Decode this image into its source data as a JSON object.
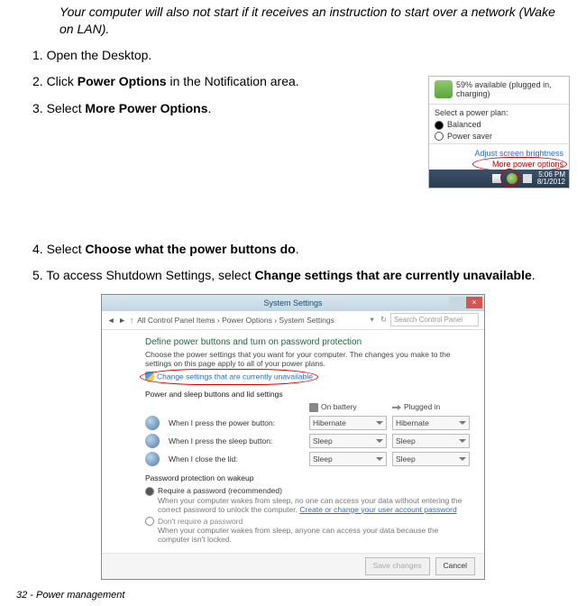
{
  "intro": "Your computer will also not start if it receives an instruction to start over a network (Wake on LAN).",
  "steps": {
    "s1": "1. Open the Desktop.",
    "s2a": "2. Click ",
    "s2b": "Power Options",
    "s2c": " in the Notification area.",
    "s3a": "3. Select ",
    "s3b": "More Power Options",
    "s3c": ".",
    "s4a": "4. Select ",
    "s4b": "Choose what the power buttons do",
    "s4c": ".",
    "s5a": "5. To access Shutdown Settings, select ",
    "s5b": "Change settings that are currently unavailable",
    "s5c": "."
  },
  "footer": "32 - Power management",
  "popup": {
    "status": "59% available (plugged in, charging)",
    "select_label": "Select a power plan:",
    "plan_balanced": "Balanced",
    "plan_saver": "Power saver",
    "adjust": "Adjust screen brightness",
    "more": "More power options",
    "time": "5:06 PM",
    "date": "8/1/2012"
  },
  "win": {
    "title": "System Settings",
    "breadcrumb": "All Control Panel Items  ›  Power Options  ›  System Settings",
    "search_ph": "Search Control Panel",
    "heading": "Define power buttons and turn on password protection",
    "sub": "Choose the power settings that you want for your computer. The changes you make to the settings on this page apply to all of your power plans.",
    "change": "Change settings that are currently unavailable",
    "section_buttons": "Power and sleep buttons and lid settings",
    "col_batt": "On battery",
    "col_plug": "Plugged in",
    "row_power": "When I press the power button:",
    "row_sleep": "When I press the sleep button:",
    "row_lid": "When I close the lid:",
    "val_hibernate": "Hibernate",
    "val_sleep": "Sleep",
    "section_pw": "Password protection on wakeup",
    "pw_req_title": "Require a password (recommended)",
    "pw_req_desc": "When your computer wakes from sleep, no one can access your data without entering the correct password to unlock the computer. ",
    "pw_req_link": "Create or change your user account password",
    "pw_noreq_title": "Don't require a password",
    "pw_noreq_desc": "When your computer wakes from sleep, anyone can access your data because the computer isn't locked.",
    "btn_save": "Save changes",
    "btn_cancel": "Cancel"
  }
}
